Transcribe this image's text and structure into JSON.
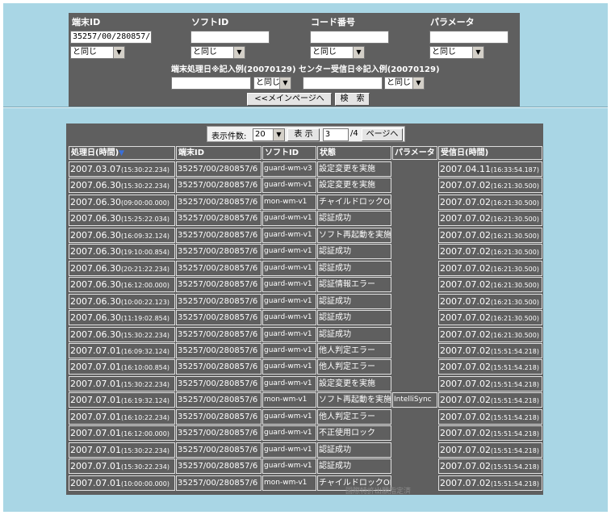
{
  "search": {
    "terminal_id_label": "端末ID",
    "terminal_id_value": "35257/00/280857/",
    "soft_id_label": "ソフトID",
    "soft_id_value": "",
    "code_label": "コード番号",
    "code_value": "",
    "param_label": "パラメータ",
    "param_value": "",
    "match_option": "と同じ",
    "date_label": "端末処理日※記入例(20070129) センター受信日※記入例(20070129)",
    "proc_date_value": "",
    "recv_date_value": "",
    "main_page_button": "<<メインページへ",
    "search_button": "検　索"
  },
  "pager": {
    "count_label": "表示件数:",
    "count_value": "20",
    "show_button": "表 示",
    "page_value": "3",
    "page_total": "/4",
    "goto_button": "ページへ"
  },
  "table": {
    "headers": {
      "date": "処理日(時間)",
      "terminal": "端末ID",
      "soft": "ソフトID",
      "status": "状態",
      "param": "パラメータ",
      "received": "受信日(時間)"
    },
    "rows": [
      {
        "d": "2007.03.07",
        "dt": "(15:30:22.234)",
        "term": "35257/00/280857/6",
        "soft": "guard-wm-v3",
        "status": "設定変更を実施",
        "param": "",
        "r": "2007.04.11",
        "rt": "(16:33:54.187)"
      },
      {
        "d": "2007.06.30",
        "dt": "(15:30:22.234)",
        "term": "35257/00/280857/6",
        "soft": "guard-wm-v1",
        "status": "設定変更を実施",
        "param": "",
        "r": "2007.07.02",
        "rt": "(16:21:30.500)"
      },
      {
        "d": "2007.06.30",
        "dt": "(09:00:00.000)",
        "term": "35257/00/280857/6",
        "soft": "mon-wm-v1",
        "status": "チャイルドロックON",
        "param": "",
        "r": "2007.07.02",
        "rt": "(16:21:30.500)"
      },
      {
        "d": "2007.06.30",
        "dt": "(15:25:22.034)",
        "term": "35257/00/280857/6",
        "soft": "guard-wm-v1",
        "status": "認証成功",
        "param": "",
        "r": "2007.07.02",
        "rt": "(16:21:30.500)"
      },
      {
        "d": "2007.06.30",
        "dt": "(16:09:32.124)",
        "term": "35257/00/280857/6",
        "soft": "guard-wm-v1",
        "status": "ソフト再起動を実施",
        "param": "",
        "r": "2007.07.02",
        "rt": "(16:21:30.500)"
      },
      {
        "d": "2007.06.30",
        "dt": "(19:10:00.854)",
        "term": "35257/00/280857/6",
        "soft": "guard-wm-v1",
        "status": "認証成功",
        "param": "",
        "r": "2007.07.02",
        "rt": "(16:21:30.500)"
      },
      {
        "d": "2007.06.30",
        "dt": "(20:21:22.234)",
        "term": "35257/00/280857/6",
        "soft": "guard-wm-v1",
        "status": "認証成功",
        "param": "",
        "r": "2007.07.02",
        "rt": "(16:21:30.500)"
      },
      {
        "d": "2007.06.30",
        "dt": "(16:12:00.000)",
        "term": "35257/00/280857/6",
        "soft": "guard-wm-v1",
        "status": "認証情報エラー",
        "param": "",
        "r": "2007.07.02",
        "rt": "(16:21:30.500)"
      },
      {
        "d": "2007.06.30",
        "dt": "(10:00:22.123)",
        "term": "35257/00/280857/6",
        "soft": "guard-wm-v1",
        "status": "認証成功",
        "param": "",
        "r": "2007.07.02",
        "rt": "(16:21:30.500)"
      },
      {
        "d": "2007.06.30",
        "dt": "(11:19:02.854)",
        "term": "35257/00/280857/6",
        "soft": "guard-wm-v1",
        "status": "認証成功",
        "param": "",
        "r": "2007.07.02",
        "rt": "(16:21:30.500)"
      },
      {
        "d": "2007.06.30",
        "dt": "(15:30:22.234)",
        "term": "35257/00/280857/6",
        "soft": "guard-wm-v1",
        "status": "認証成功",
        "param": "",
        "r": "2007.07.02",
        "rt": "(16:21:30.500)"
      },
      {
        "d": "2007.07.01",
        "dt": "(16:09:32.124)",
        "term": "35257/00/280857/6",
        "soft": "guard-wm-v1",
        "status": "他人判定エラー",
        "param": "",
        "r": "2007.07.02",
        "rt": "(15:51:54.218)"
      },
      {
        "d": "2007.07.01",
        "dt": "(16:10:00.854)",
        "term": "35257/00/280857/6",
        "soft": "guard-wm-v1",
        "status": "他人判定エラー",
        "param": "",
        "r": "2007.07.02",
        "rt": "(15:51:54.218)"
      },
      {
        "d": "2007.07.01",
        "dt": "(15:30:22.234)",
        "term": "35257/00/280857/6",
        "soft": "guard-wm-v1",
        "status": "設定変更を実施",
        "param": "",
        "r": "2007.07.02",
        "rt": "(15:51:54.218)"
      },
      {
        "d": "2007.07.01",
        "dt": "(16:19:32.124)",
        "term": "35257/00/280857/6",
        "soft": "mon-wm-v1",
        "status": "ソフト再起動を実施",
        "param": "IntelliSync",
        "r": "2007.07.02",
        "rt": "(15:51:54.218)"
      },
      {
        "d": "2007.07.01",
        "dt": "(16:10:22.234)",
        "term": "35257/00/280857/6",
        "soft": "guard-wm-v1",
        "status": "他人判定エラー",
        "param": "",
        "r": "2007.07.02",
        "rt": "(15:51:54.218)"
      },
      {
        "d": "2007.07.01",
        "dt": "(16:12:00.000)",
        "term": "35257/00/280857/6",
        "soft": "guard-wm-v1",
        "status": "不正使用ロック",
        "param": "",
        "r": "2007.07.02",
        "rt": "(15:51:54.218)"
      },
      {
        "d": "2007.07.01",
        "dt": "(15:30:22.234)",
        "term": "35257/00/280857/6",
        "soft": "guard-wm-v1",
        "status": "認証成功",
        "param": "",
        "r": "2007.07.02",
        "rt": "(15:51:54.218)"
      },
      {
        "d": "2007.07.01",
        "dt": "(15:30:22.234)",
        "term": "35257/00/280857/6",
        "soft": "guard-wm-v1",
        "status": "認証成功",
        "param": "",
        "r": "2007.07.02",
        "rt": "(15:51:54.218)"
      },
      {
        "d": "2007.07.01",
        "dt": "(10:00:00.000)",
        "term": "35257/00/280857/6",
        "soft": "mon-wm-v1",
        "status": "チャイルドロックON",
        "param": "",
        "r": "2007.07.02",
        "rt": "(15:51:54.218)"
      }
    ]
  },
  "icons": {
    "sort": "sort-desc-triangle",
    "dropdown": "dropdown-arrow"
  },
  "watermark": "国際特許出願指定済"
}
